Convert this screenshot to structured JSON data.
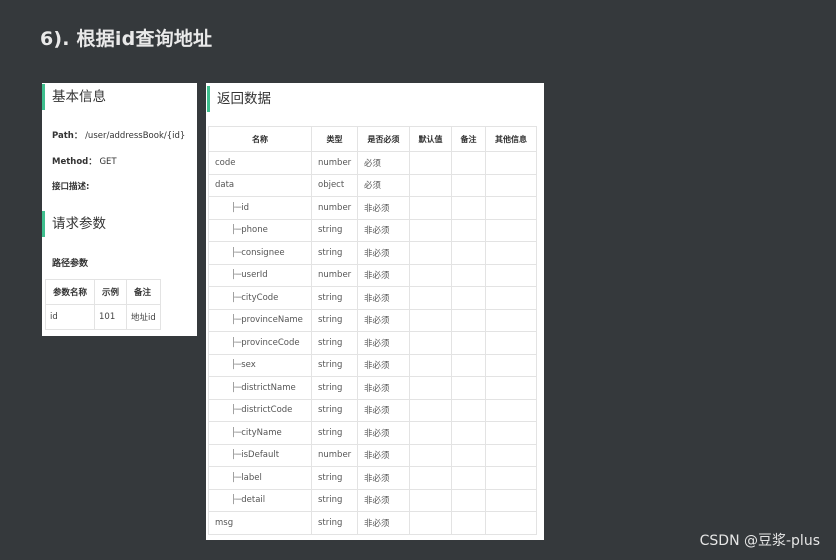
{
  "page": {
    "heading": "6). 根据id查询地址",
    "watermark": "CSDN @豆浆-plus"
  },
  "basic_info": {
    "title": "基本信息",
    "path_label": "Path：",
    "path_value": "/user/addressBook/{id}",
    "method_label": "Method：",
    "method_value": "GET",
    "desc_label": "接口描述:"
  },
  "request_params": {
    "title": "请求参数",
    "path_params_title": "路径参数",
    "headers": [
      "参数名称",
      "示例",
      "备注"
    ],
    "rows": [
      [
        "id",
        "101",
        "地址id"
      ]
    ]
  },
  "response": {
    "title": "返回数据",
    "headers": [
      "名称",
      "类型",
      "是否必须",
      "默认值",
      "备注",
      "其他信息"
    ],
    "rows": [
      {
        "prefix": "",
        "name": "code",
        "type": "number",
        "required": "必须"
      },
      {
        "prefix": "",
        "name": "data",
        "type": "object",
        "required": "必须"
      },
      {
        "prefix": "├─",
        "name": "id",
        "type": "number",
        "required": "非必须"
      },
      {
        "prefix": "├─",
        "name": "phone",
        "type": "string",
        "required": "非必须"
      },
      {
        "prefix": "├─",
        "name": "consignee",
        "type": "string",
        "required": "非必须"
      },
      {
        "prefix": "├─",
        "name": "userId",
        "type": "number",
        "required": "非必须"
      },
      {
        "prefix": "├─",
        "name": "cityCode",
        "type": "string",
        "required": "非必须"
      },
      {
        "prefix": "├─",
        "name": "provinceName",
        "type": "string",
        "required": "非必须"
      },
      {
        "prefix": "├─",
        "name": "provinceCode",
        "type": "string",
        "required": "非必须"
      },
      {
        "prefix": "├─",
        "name": "sex",
        "type": "string",
        "required": "非必须"
      },
      {
        "prefix": "├─",
        "name": "districtName",
        "type": "string",
        "required": "非必须"
      },
      {
        "prefix": "├─",
        "name": "districtCode",
        "type": "string",
        "required": "非必须"
      },
      {
        "prefix": "├─",
        "name": "cityName",
        "type": "string",
        "required": "非必须"
      },
      {
        "prefix": "├─",
        "name": "isDefault",
        "type": "number",
        "required": "非必须"
      },
      {
        "prefix": "├─",
        "name": "label",
        "type": "string",
        "required": "非必须"
      },
      {
        "prefix": "├─",
        "name": "detail",
        "type": "string",
        "required": "非必须"
      },
      {
        "prefix": "",
        "name": "msg",
        "type": "string",
        "required": "非必须"
      }
    ]
  },
  "colors": {
    "background": "#35393c",
    "accent": "#3fbf8e",
    "heading_text": "#e9e9e9"
  }
}
